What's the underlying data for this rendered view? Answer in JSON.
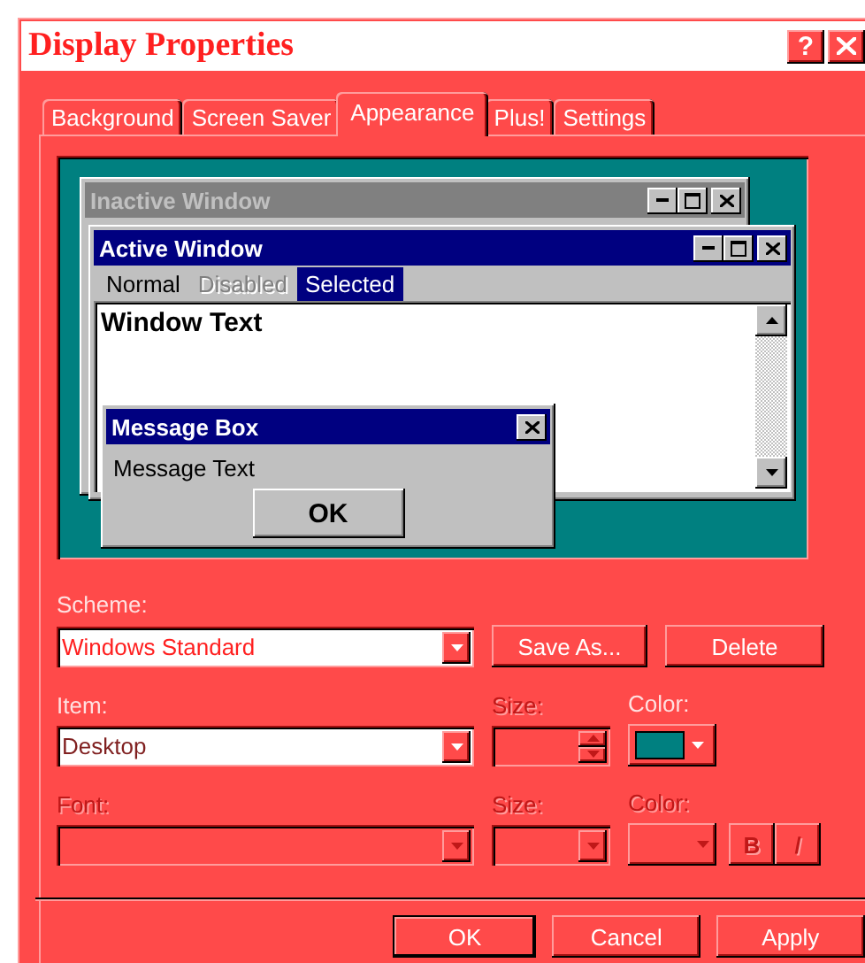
{
  "window": {
    "title": "Display Properties",
    "help": "?"
  },
  "tabs": [
    {
      "label": "Background",
      "selected": false
    },
    {
      "label": "Screen Saver",
      "selected": false
    },
    {
      "label": "Appearance",
      "selected": true
    },
    {
      "label": "Plus!",
      "selected": false
    },
    {
      "label": "Settings",
      "selected": false
    }
  ],
  "preview": {
    "inactive_window": {
      "title": "Inactive Window"
    },
    "active_window": {
      "title": "Active Window",
      "menu": [
        {
          "label": "Normal",
          "disabled": false,
          "selected": false
        },
        {
          "label": "Disabled",
          "disabled": true,
          "selected": false
        },
        {
          "label": "Selected",
          "disabled": false,
          "selected": true
        }
      ],
      "text": "Window Text"
    },
    "message_box": {
      "title": "Message Box",
      "text": "Message Text",
      "button": "OK"
    }
  },
  "scheme": {
    "label": "Scheme:",
    "value": "Windows Standard",
    "buttons": [
      "Save As...",
      "Delete"
    ]
  },
  "item": {
    "label": "Item:",
    "value": "Desktop",
    "size": {
      "label": "Size:",
      "disabled": true
    },
    "color": {
      "label": "Color:",
      "disabled": false,
      "color": "#008080"
    }
  },
  "font": {
    "label": "Font:",
    "disabled": true,
    "size": {
      "label": "Size:",
      "disabled": true
    },
    "color": {
      "label": "Color:",
      "disabled": true
    },
    "bold": {
      "label": "B",
      "disabled": true
    },
    "italic": {
      "label": "/",
      "disabled": true
    }
  },
  "buttons": [
    "OK",
    "Cancel",
    "Apply"
  ]
}
